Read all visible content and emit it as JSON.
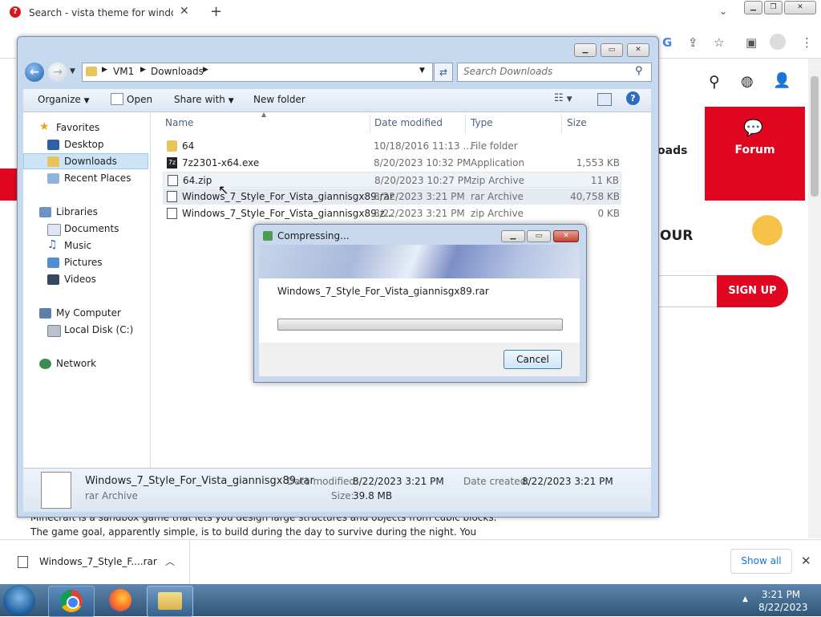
{
  "browser": {
    "tab_title": "Search - vista theme for windows",
    "tab_close": "✕",
    "new_tab": "+",
    "tab_search": "⌄"
  },
  "website": {
    "nav_downloads": "oads",
    "forum_label": "Forum",
    "heading_fragment": "OUR",
    "signup": "SIGN UP",
    "paragraph_line1": "Minecraft is a sandbox game that lets you design large structures and objects from cubic blocks.",
    "paragraph_line2": "The game goal, apparently simple, is to build during the day to survive during the night. You"
  },
  "explorer": {
    "breadcrumb": [
      "VM1",
      "Downloads"
    ],
    "search_placeholder": "Search Downloads",
    "toolbar": {
      "organize": "Organize",
      "open": "Open",
      "share_with": "Share with",
      "new_folder": "New folder"
    },
    "nav": {
      "favorites": "Favorites",
      "desktop": "Desktop",
      "downloads": "Downloads",
      "recent_places": "Recent Places",
      "libraries": "Libraries",
      "documents": "Documents",
      "music": "Music",
      "pictures": "Pictures",
      "videos": "Videos",
      "my_computer": "My Computer",
      "local_disk": "Local Disk (C:)",
      "network": "Network"
    },
    "columns": {
      "name": "Name",
      "date_modified": "Date modified",
      "type": "Type",
      "size": "Size"
    },
    "files": [
      {
        "name": "64",
        "date": "10/18/2016 11:13 ...",
        "type": "File folder",
        "size": ""
      },
      {
        "name": "7z2301-x64.exe",
        "date": "8/20/2023 10:32 PM",
        "type": "Application",
        "size": "1,553 KB"
      },
      {
        "name": "64.zip",
        "date": "8/20/2023 10:27 PM",
        "type": "zip Archive",
        "size": "11 KB"
      },
      {
        "name": "Windows_7_Style_For_Vista_giannisgx89.rar",
        "date": "8/22/2023 3:21 PM",
        "type": "rar Archive",
        "size": "40,758 KB"
      },
      {
        "name": "Windows_7_Style_For_Vista_giannisgx89.z...",
        "date": "8/22/2023 3:21 PM",
        "type": "zip Archive",
        "size": "0 KB"
      }
    ],
    "details": {
      "filename": "Windows_7_Style_For_Vista_giannisgx89.rar",
      "filetype": "rar Archive",
      "date_modified_label": "Date modified:",
      "date_modified": "8/22/2023 3:21 PM",
      "date_created_label": "Date created:",
      "date_created": "8/22/2023 3:21 PM",
      "size_label": "Size:",
      "size": "39.8 MB"
    }
  },
  "dialog": {
    "title": "Compressing...",
    "filename": "Windows_7_Style_For_Vista_giannisgx89.rar",
    "progress": 0,
    "cancel": "Cancel"
  },
  "download_bar": {
    "item": "Windows_7_Style_F....rar",
    "show_all": "Show all"
  },
  "taskbar": {
    "time": "3:21 PM",
    "date": "8/22/2023"
  }
}
